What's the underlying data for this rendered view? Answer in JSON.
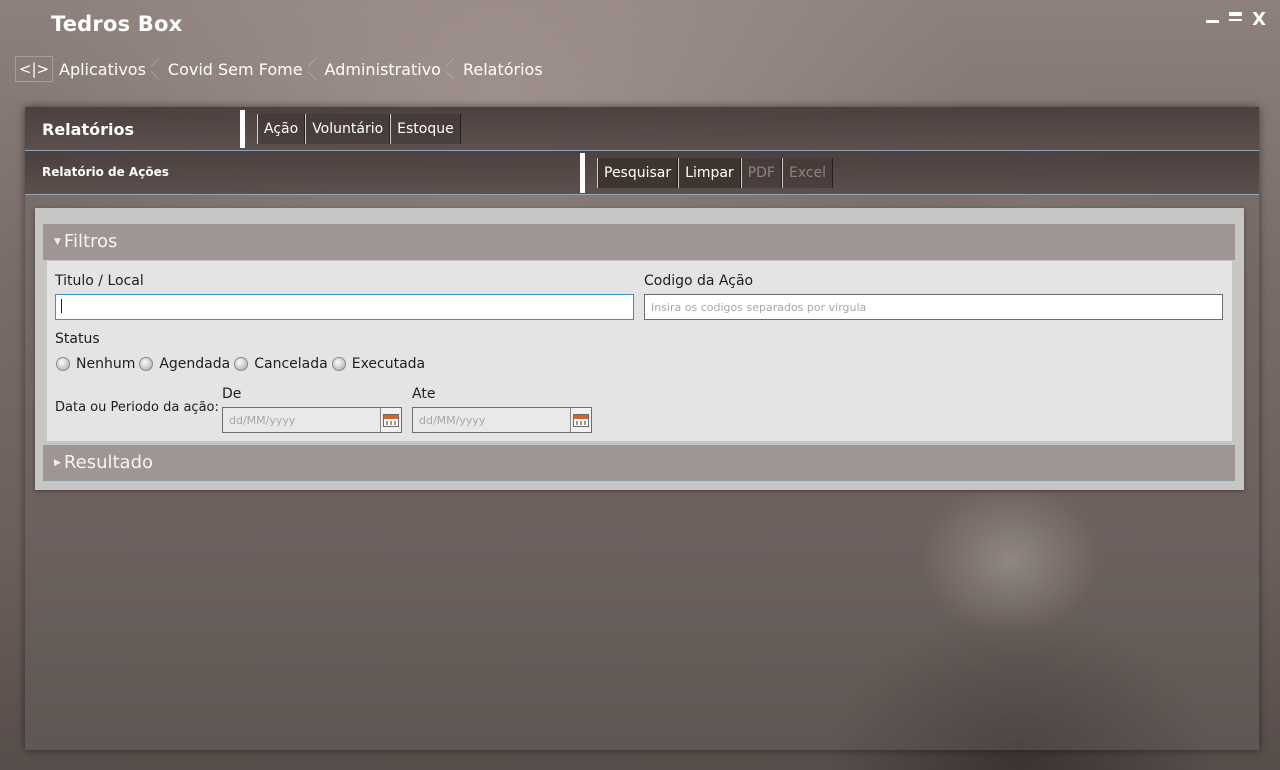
{
  "app": {
    "title": "Tedros Box"
  },
  "window_controls": {
    "close": "X"
  },
  "breadcrumb": {
    "back_label": "<|>",
    "items": [
      "Aplicativos",
      "Covid Sem Fome",
      "Administrativo",
      "Relatórios"
    ]
  },
  "module_bar": {
    "title": "Relatórios",
    "tabs": [
      "Ação",
      "Voluntário",
      "Estoque"
    ]
  },
  "report_bar": {
    "title": "Relatório de Ações",
    "actions": [
      {
        "label": "Pesquisar",
        "enabled": true
      },
      {
        "label": "Limpar",
        "enabled": true
      },
      {
        "label": "PDF",
        "enabled": false
      },
      {
        "label": "Excel",
        "enabled": false
      }
    ]
  },
  "filters": {
    "header": "Filtros",
    "expanded": true,
    "titulo_label": "Titulo / Local",
    "titulo_value": "",
    "codigo_label": "Codigo da Ação",
    "codigo_placeholder": "Insira os codigos separados por virgula",
    "status_label": "Status",
    "status_options": [
      "Nenhum",
      "Agendada",
      "Cancelada",
      "Executada"
    ],
    "status_selected": null,
    "periodo_label": "Data ou Periodo da ação:",
    "de_label": "De",
    "ate_label": "Ate",
    "date_placeholder": "dd/MM/yyyy"
  },
  "resultado": {
    "header": "Resultado",
    "expanded": false
  },
  "colors": {
    "bar_bg": "#4a3e3c",
    "section_header_bg": "#9f9593",
    "input_focus_border": "#3f8fc9",
    "calendar_accent": "#d9622b"
  }
}
